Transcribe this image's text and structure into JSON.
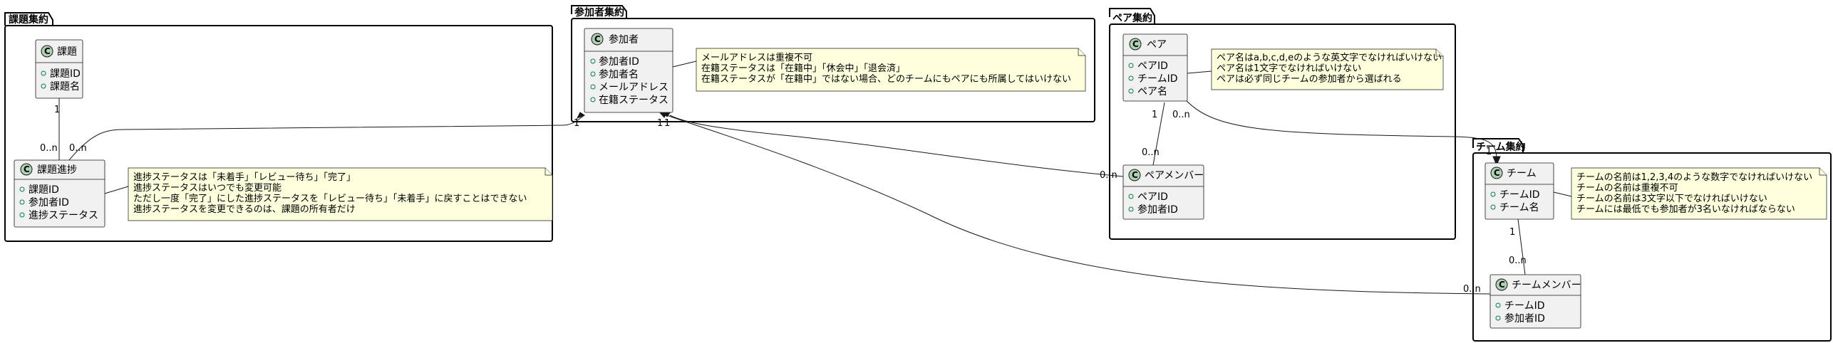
{
  "packages": {
    "kadai": "課題集約",
    "sankasha": "参加者集約",
    "pair": "ペア集約",
    "team": "チーム集約"
  },
  "classes": {
    "kadai": {
      "name": "課題",
      "attrs": [
        "課題ID",
        "課題名"
      ]
    },
    "kadai_shinchoku": {
      "name": "課題進捗",
      "attrs": [
        "課題ID",
        "参加者ID",
        "進捗ステータス"
      ]
    },
    "sankasha": {
      "name": "参加者",
      "attrs": [
        "参加者ID",
        "参加者名",
        "メールアドレス",
        "在籍ステータス"
      ]
    },
    "pair": {
      "name": "ペア",
      "attrs": [
        "ペアID",
        "チームID",
        "ペア名"
      ]
    },
    "pair_member": {
      "name": "ペアメンバー",
      "attrs": [
        "ペアID",
        "参加者ID"
      ]
    },
    "team": {
      "name": "チーム",
      "attrs": [
        "チームID",
        "チーム名"
      ]
    },
    "team_member": {
      "name": "チームメンバー",
      "attrs": [
        "チームID",
        "参加者ID"
      ]
    }
  },
  "notes": {
    "kadai_shinchoku": [
      "進捗ステータスは「未着手」「レビュー待ち」「完了」",
      "進捗ステータスはいつでも変更可能",
      "ただし一度「完了」にした進捗ステータスを「レビュー待ち」「未着手」に戻すことはできない",
      "進捗ステータスを変更できるのは、課題の所有者だけ"
    ],
    "sankasha": [
      "メールアドレスは重複不可",
      "在籍ステータスは「在籍中」「休会中」「退会済」",
      "在籍ステータスが「在籍中」ではない場合、どのチームにもペアにも所属してはいけない"
    ],
    "pair": [
      "ペア名はa,b,c,d,eのような英文字でなければいけない",
      "ペア名は1文字でなければいけない",
      "ペアは必ず同じチームの参加者から選ばれる"
    ],
    "team": [
      "チームの名前は1,2,3,4のような数字でなければいけない",
      "チームの名前は重複不可",
      "チームの名前は3文字以下でなければいけない",
      "チームには最低でも参加者が3名いなければならない"
    ]
  },
  "multiplicities": {
    "kadai_to_shinchoku_one": "1",
    "kadai_to_shinchoku_many": "0..n",
    "shinchoku_to_sankasha_many": "0..n",
    "shinchoku_to_sankasha_one": "1",
    "pair_to_member_one": "1",
    "pair_to_member_many": "0..n",
    "pairmember_to_sankasha_many": "0..n",
    "pairmember_to_sankasha_one": "1",
    "pair_to_team_many": "0..n",
    "pair_to_team_one": "1",
    "team_to_member_one": "1",
    "team_to_member_many": "0..n",
    "teammember_to_sankasha_many": "0..n",
    "teammember_to_sankasha_one": "1"
  },
  "colors": {
    "class_fill": "#f1f1f1",
    "class_icon": "#add1b2",
    "attr_marker": "#038048",
    "note_fill": "#feffdd",
    "line": "#181818"
  }
}
